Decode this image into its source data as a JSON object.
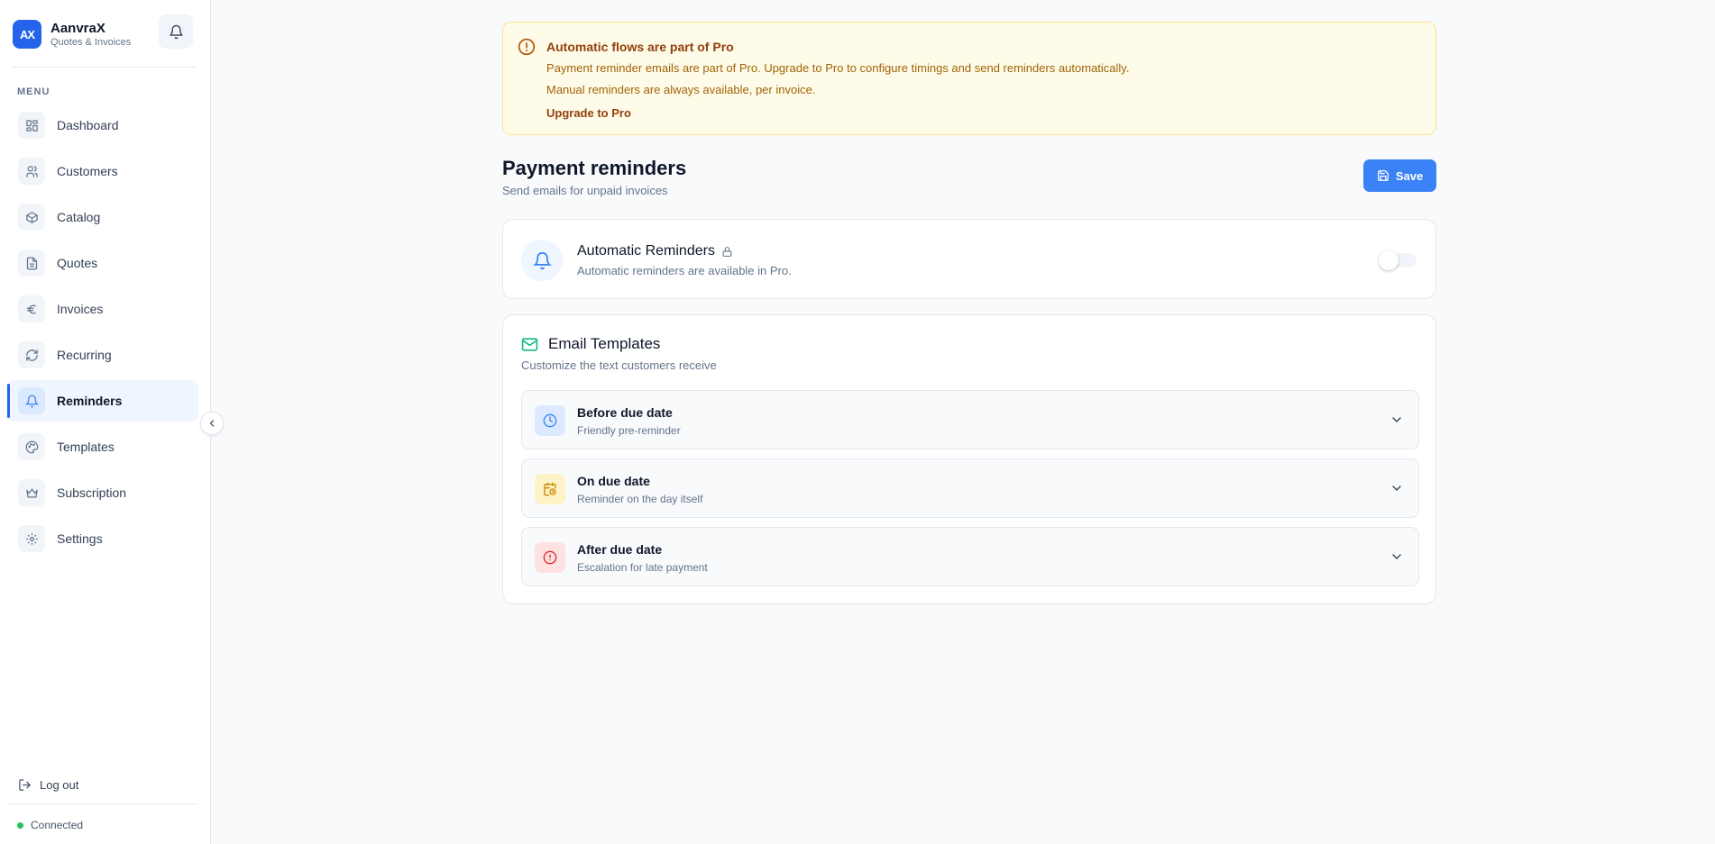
{
  "brand": {
    "logo": "AX",
    "name": "AanvraX",
    "subtitle": "Quotes & Invoices"
  },
  "sidebar": {
    "menu_label": "MENU",
    "items": [
      {
        "label": "Dashboard",
        "icon": "dashboard-icon"
      },
      {
        "label": "Customers",
        "icon": "users-icon"
      },
      {
        "label": "Catalog",
        "icon": "box-icon"
      },
      {
        "label": "Quotes",
        "icon": "document-icon"
      },
      {
        "label": "Invoices",
        "icon": "euro-icon"
      },
      {
        "label": "Recurring",
        "icon": "refresh-icon"
      },
      {
        "label": "Reminders",
        "icon": "bell-icon",
        "active": true
      },
      {
        "label": "Templates",
        "icon": "palette-icon"
      },
      {
        "label": "Subscription",
        "icon": "crown-icon"
      },
      {
        "label": "Settings",
        "icon": "gear-icon"
      }
    ],
    "logout_label": "Log out",
    "status_label": "Connected"
  },
  "banner": {
    "title": "Automatic flows are part of Pro",
    "line1": "Payment reminder emails are part of Pro. Upgrade to Pro to configure timings and send reminders automatically.",
    "line2": "Manual reminders are always available, per invoice.",
    "link": "Upgrade to Pro"
  },
  "page": {
    "title": "Payment reminders",
    "subtitle": "Send emails for unpaid invoices",
    "save_label": "Save"
  },
  "automatic": {
    "title": "Automatic Reminders",
    "subtitle": "Automatic reminders are available in Pro.",
    "enabled": false
  },
  "templates": {
    "title": "Email Templates",
    "subtitle": "Customize the text customers receive",
    "items": [
      {
        "title": "Before due date",
        "subtitle": "Friendly pre-reminder",
        "icon": "clock-icon",
        "color": "#3b82f6",
        "bg": "#dbeafe"
      },
      {
        "title": "On due date",
        "subtitle": "Reminder on the day itself",
        "icon": "calendar-clock-icon",
        "color": "#ca8a04",
        "bg": "#fef3c7"
      },
      {
        "title": "After due date",
        "subtitle": "Escalation for late payment",
        "icon": "alert-circle-icon",
        "color": "#dc2626",
        "bg": "#fee2e2"
      }
    ]
  },
  "colors": {
    "accent": "#3b82f6",
    "active_bar": "#2563eb",
    "status_ok": "#22c55e",
    "banner_bg": "#fefce8"
  }
}
